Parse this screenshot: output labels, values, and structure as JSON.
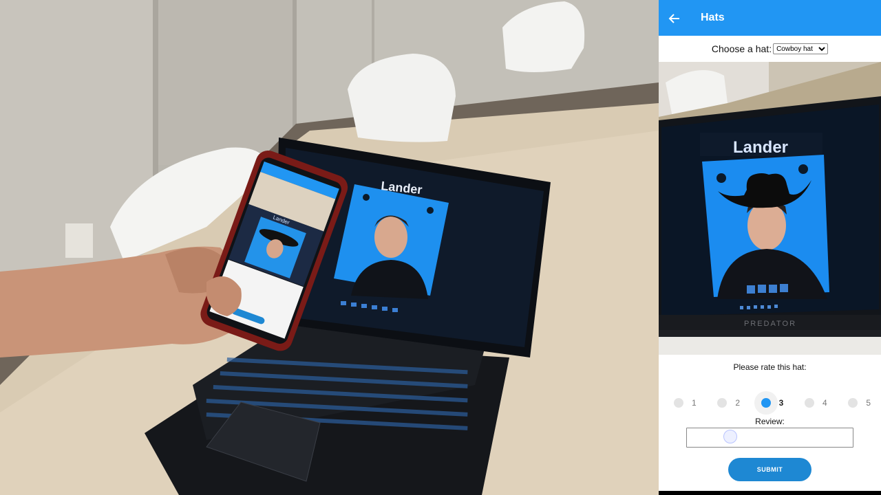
{
  "photo": {
    "laptop_screen_name": "Lander",
    "phone_screen_name": "Lander"
  },
  "app": {
    "title": "Hats",
    "chooser": {
      "label": "Choose a hat:",
      "selected": "Cowboy hat"
    },
    "preview": {
      "name_banner": "Lander",
      "laptop_brand": "PREDATOR"
    },
    "rating": {
      "label": "Please rate this hat:",
      "options": [
        "1",
        "2",
        "3",
        "4",
        "5"
      ],
      "selected": "3"
    },
    "review": {
      "label": "Review:",
      "value": ""
    },
    "submit_label": "SUBMIT"
  }
}
